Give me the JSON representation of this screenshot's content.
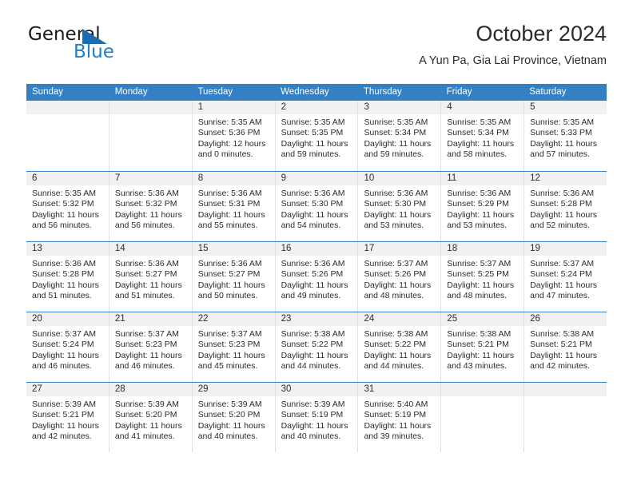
{
  "brand": {
    "name_part1": "General",
    "name_part2": "Blue",
    "logo_icon": "triangle-logo-icon",
    "accent_color": "#1b6cb0"
  },
  "header": {
    "title": "October 2024",
    "subtitle": "A Yun Pa, Gia Lai Province, Vietnam"
  },
  "calendar": {
    "header_bg": "#3480c4",
    "day_band_bg": "#f1f1f1",
    "weekdays": [
      "Sunday",
      "Monday",
      "Tuesday",
      "Wednesday",
      "Thursday",
      "Friday",
      "Saturday"
    ],
    "weeks": [
      [
        {
          "day": "",
          "sunrise": "",
          "sunset": "",
          "daylight": "",
          "empty": true
        },
        {
          "day": "",
          "sunrise": "",
          "sunset": "",
          "daylight": "",
          "empty": true
        },
        {
          "day": "1",
          "sunrise": "Sunrise: 5:35 AM",
          "sunset": "Sunset: 5:36 PM",
          "daylight": "Daylight: 12 hours and 0 minutes."
        },
        {
          "day": "2",
          "sunrise": "Sunrise: 5:35 AM",
          "sunset": "Sunset: 5:35 PM",
          "daylight": "Daylight: 11 hours and 59 minutes."
        },
        {
          "day": "3",
          "sunrise": "Sunrise: 5:35 AM",
          "sunset": "Sunset: 5:34 PM",
          "daylight": "Daylight: 11 hours and 59 minutes."
        },
        {
          "day": "4",
          "sunrise": "Sunrise: 5:35 AM",
          "sunset": "Sunset: 5:34 PM",
          "daylight": "Daylight: 11 hours and 58 minutes."
        },
        {
          "day": "5",
          "sunrise": "Sunrise: 5:35 AM",
          "sunset": "Sunset: 5:33 PM",
          "daylight": "Daylight: 11 hours and 57 minutes."
        }
      ],
      [
        {
          "day": "6",
          "sunrise": "Sunrise: 5:35 AM",
          "sunset": "Sunset: 5:32 PM",
          "daylight": "Daylight: 11 hours and 56 minutes."
        },
        {
          "day": "7",
          "sunrise": "Sunrise: 5:36 AM",
          "sunset": "Sunset: 5:32 PM",
          "daylight": "Daylight: 11 hours and 56 minutes."
        },
        {
          "day": "8",
          "sunrise": "Sunrise: 5:36 AM",
          "sunset": "Sunset: 5:31 PM",
          "daylight": "Daylight: 11 hours and 55 minutes."
        },
        {
          "day": "9",
          "sunrise": "Sunrise: 5:36 AM",
          "sunset": "Sunset: 5:30 PM",
          "daylight": "Daylight: 11 hours and 54 minutes."
        },
        {
          "day": "10",
          "sunrise": "Sunrise: 5:36 AM",
          "sunset": "Sunset: 5:30 PM",
          "daylight": "Daylight: 11 hours and 53 minutes."
        },
        {
          "day": "11",
          "sunrise": "Sunrise: 5:36 AM",
          "sunset": "Sunset: 5:29 PM",
          "daylight": "Daylight: 11 hours and 53 minutes."
        },
        {
          "day": "12",
          "sunrise": "Sunrise: 5:36 AM",
          "sunset": "Sunset: 5:28 PM",
          "daylight": "Daylight: 11 hours and 52 minutes."
        }
      ],
      [
        {
          "day": "13",
          "sunrise": "Sunrise: 5:36 AM",
          "sunset": "Sunset: 5:28 PM",
          "daylight": "Daylight: 11 hours and 51 minutes."
        },
        {
          "day": "14",
          "sunrise": "Sunrise: 5:36 AM",
          "sunset": "Sunset: 5:27 PM",
          "daylight": "Daylight: 11 hours and 51 minutes."
        },
        {
          "day": "15",
          "sunrise": "Sunrise: 5:36 AM",
          "sunset": "Sunset: 5:27 PM",
          "daylight": "Daylight: 11 hours and 50 minutes."
        },
        {
          "day": "16",
          "sunrise": "Sunrise: 5:36 AM",
          "sunset": "Sunset: 5:26 PM",
          "daylight": "Daylight: 11 hours and 49 minutes."
        },
        {
          "day": "17",
          "sunrise": "Sunrise: 5:37 AM",
          "sunset": "Sunset: 5:26 PM",
          "daylight": "Daylight: 11 hours and 48 minutes."
        },
        {
          "day": "18",
          "sunrise": "Sunrise: 5:37 AM",
          "sunset": "Sunset: 5:25 PM",
          "daylight": "Daylight: 11 hours and 48 minutes."
        },
        {
          "day": "19",
          "sunrise": "Sunrise: 5:37 AM",
          "sunset": "Sunset: 5:24 PM",
          "daylight": "Daylight: 11 hours and 47 minutes."
        }
      ],
      [
        {
          "day": "20",
          "sunrise": "Sunrise: 5:37 AM",
          "sunset": "Sunset: 5:24 PM",
          "daylight": "Daylight: 11 hours and 46 minutes."
        },
        {
          "day": "21",
          "sunrise": "Sunrise: 5:37 AM",
          "sunset": "Sunset: 5:23 PM",
          "daylight": "Daylight: 11 hours and 46 minutes."
        },
        {
          "day": "22",
          "sunrise": "Sunrise: 5:37 AM",
          "sunset": "Sunset: 5:23 PM",
          "daylight": "Daylight: 11 hours and 45 minutes."
        },
        {
          "day": "23",
          "sunrise": "Sunrise: 5:38 AM",
          "sunset": "Sunset: 5:22 PM",
          "daylight": "Daylight: 11 hours and 44 minutes."
        },
        {
          "day": "24",
          "sunrise": "Sunrise: 5:38 AM",
          "sunset": "Sunset: 5:22 PM",
          "daylight": "Daylight: 11 hours and 44 minutes."
        },
        {
          "day": "25",
          "sunrise": "Sunrise: 5:38 AM",
          "sunset": "Sunset: 5:21 PM",
          "daylight": "Daylight: 11 hours and 43 minutes."
        },
        {
          "day": "26",
          "sunrise": "Sunrise: 5:38 AM",
          "sunset": "Sunset: 5:21 PM",
          "daylight": "Daylight: 11 hours and 42 minutes."
        }
      ],
      [
        {
          "day": "27",
          "sunrise": "Sunrise: 5:39 AM",
          "sunset": "Sunset: 5:21 PM",
          "daylight": "Daylight: 11 hours and 42 minutes."
        },
        {
          "day": "28",
          "sunrise": "Sunrise: 5:39 AM",
          "sunset": "Sunset: 5:20 PM",
          "daylight": "Daylight: 11 hours and 41 minutes."
        },
        {
          "day": "29",
          "sunrise": "Sunrise: 5:39 AM",
          "sunset": "Sunset: 5:20 PM",
          "daylight": "Daylight: 11 hours and 40 minutes."
        },
        {
          "day": "30",
          "sunrise": "Sunrise: 5:39 AM",
          "sunset": "Sunset: 5:19 PM",
          "daylight": "Daylight: 11 hours and 40 minutes."
        },
        {
          "day": "31",
          "sunrise": "Sunrise: 5:40 AM",
          "sunset": "Sunset: 5:19 PM",
          "daylight": "Daylight: 11 hours and 39 minutes."
        },
        {
          "day": "",
          "sunrise": "",
          "sunset": "",
          "daylight": "",
          "empty": true
        },
        {
          "day": "",
          "sunrise": "",
          "sunset": "",
          "daylight": "",
          "empty": true
        }
      ]
    ]
  }
}
